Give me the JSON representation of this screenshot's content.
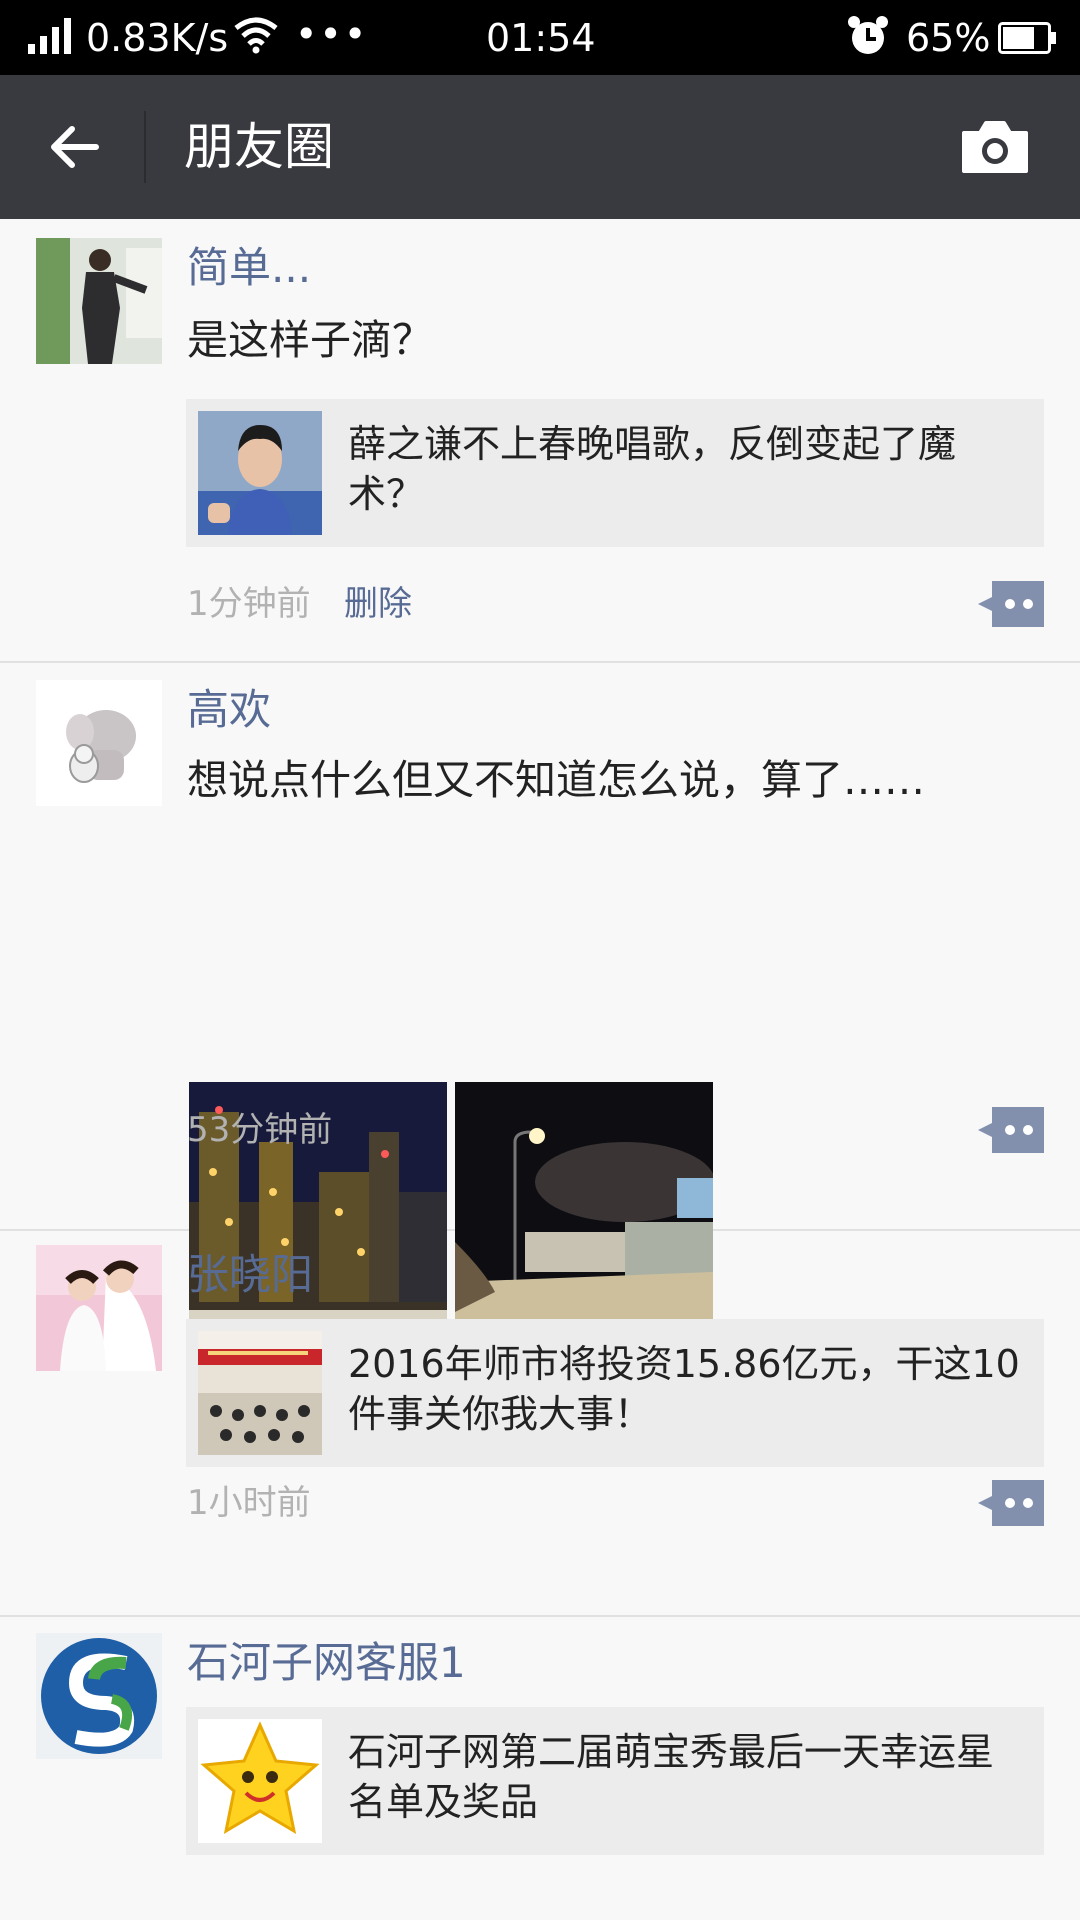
{
  "status_bar": {
    "speed": "0.83K/s",
    "dots": "•••",
    "time": "01:54",
    "battery": "65%"
  },
  "app_bar": {
    "title": "朋友圈"
  },
  "icons": {
    "back": "arrow-left-icon",
    "camera": "camera-icon",
    "comment": "comment-more-icon"
  },
  "colors": {
    "accent_name": "#576b95",
    "app_bar": "#393a3f"
  },
  "posts": [
    {
      "name": "简单...",
      "text": "是这样子滴？",
      "link_title": "薛之谦不上春晚唱歌，反倒变起了魔术？",
      "time": "1分钟前",
      "delete_label": "删除"
    },
    {
      "name": "高欢",
      "text": "想说点什么但又不知道怎么说，算了……",
      "time": "53分钟前"
    },
    {
      "name": "张晓阳",
      "link_title": "2016年师市将投资15.86亿元，干这10件事关你我大事！",
      "time": "1小时前"
    },
    {
      "name": "石河子网客服1",
      "link_title": "石河子网第二届萌宝秀最后一天幸运星名单及奖品"
    }
  ]
}
